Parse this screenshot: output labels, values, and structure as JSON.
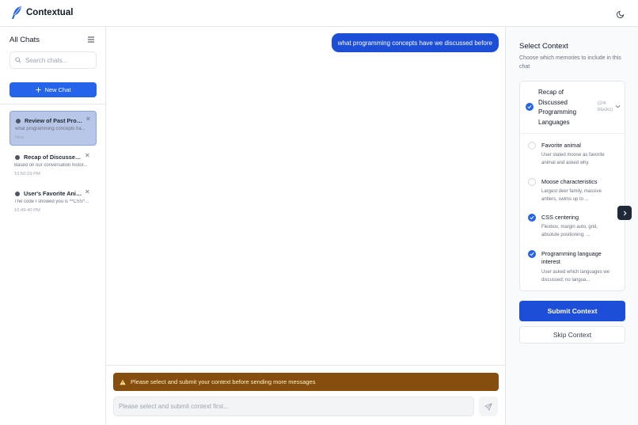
{
  "app": {
    "name": "Contextual"
  },
  "icons": {
    "logo": "feather-logo-icon",
    "theme": "moon-icon",
    "menu": "hamburger-icon",
    "search": "search-icon",
    "new_chat": "plus-icon",
    "warning": "warning-icon",
    "send": "send-icon",
    "next": "chevron-right-icon"
  },
  "colors": {
    "accent": "#2563eb",
    "warning_bg": "#854d0e",
    "active_chat": "#b8c7e8"
  },
  "sidebar": {
    "title": "All Chats",
    "search_placeholder": "Search chats...",
    "new_chat_label": "New Chat",
    "chats": [
      {
        "title": "Review of Past Progr...",
        "preview": "what programming concepts ha...",
        "time": "Now",
        "active": true
      },
      {
        "title": "Recap of Discussed ...",
        "preview": "Based on our conversation histor...",
        "time": "10:50:29 PM",
        "active": false
      },
      {
        "title": "User's Favorite Anim...",
        "preview": "The code I showed you is **CSS*...",
        "time": "10:49:40 PM",
        "active": false
      }
    ]
  },
  "main": {
    "messages": [
      {
        "role": "user",
        "text": "what programming concepts have we discussed before"
      }
    ],
    "warning": "Please select and submit your context before sending more messages",
    "input_placeholder": "Please select and submit context first..."
  },
  "context_panel": {
    "title": "Select Context",
    "subtitle": "Choose which memories to include in this chat",
    "group": {
      "title": "Recap of Discussed Programming Languages",
      "count": "(2/4 blocks)",
      "checked": true
    },
    "memories": [
      {
        "title": "Favorite animal",
        "desc": "User stated moose as favorite animal and asked why.",
        "checked": false
      },
      {
        "title": "Moose characteristics",
        "desc": "Largest deer family, massive antlers, swims up to ...",
        "checked": false
      },
      {
        "title": "CSS centering",
        "desc": "Flexbox, margin auto, grid, absolute positioning; ...",
        "checked": true
      },
      {
        "title": "Programming language interest",
        "desc": "User asked which languages we discussed; no langua...",
        "checked": true
      }
    ],
    "submit_label": "Submit Context",
    "skip_label": "Skip Context"
  }
}
